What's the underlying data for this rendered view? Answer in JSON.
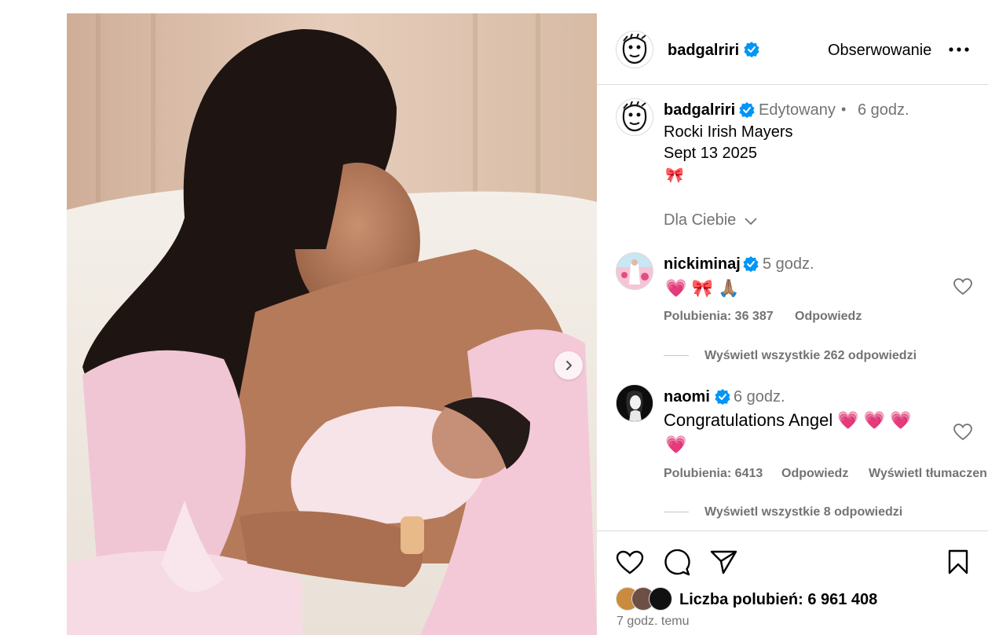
{
  "post_author": {
    "username": "badgalriri",
    "follow_label": "Obserwowanie"
  },
  "caption": {
    "username": "badgalriri",
    "edited": "Edytowany",
    "separator": "•",
    "time": "6 godz.",
    "line1": "Rocki Irish Mayers",
    "line2": "Sept 13 2025",
    "line3": "🎀"
  },
  "filter": {
    "label": "Dla Ciebie"
  },
  "comments": [
    {
      "username": "nickiminaj",
      "time": "5 godz.",
      "text": "💗 🎀 🙏🏽",
      "likes": "Polubienia: 36 387",
      "reply": "Odpowiedz",
      "view_replies": "Wyświetl wszystkie 262 odpowiedzi"
    },
    {
      "username": "naomi",
      "time": "6 godz.",
      "text_line1": "Congratulations Angel 💗 💗 💗",
      "text_line2": "💗",
      "likes": "Polubienia: 6413",
      "reply": "Odpowiedz",
      "translate": "Wyświetl tłumaczenie",
      "view_replies": "Wyświetl wszystkie 8 odpowiedzi"
    }
  ],
  "actions": {
    "icons": [
      "heart-icon",
      "comment-icon",
      "share-icon",
      "bookmark-icon"
    ]
  },
  "likes": {
    "label": "Liczba polubień: 6 961 408"
  },
  "timestamp": "7 godz. temu",
  "colors": {
    "verified": "#0095f6",
    "muted": "#737373",
    "divider": "#dbdbdb"
  }
}
